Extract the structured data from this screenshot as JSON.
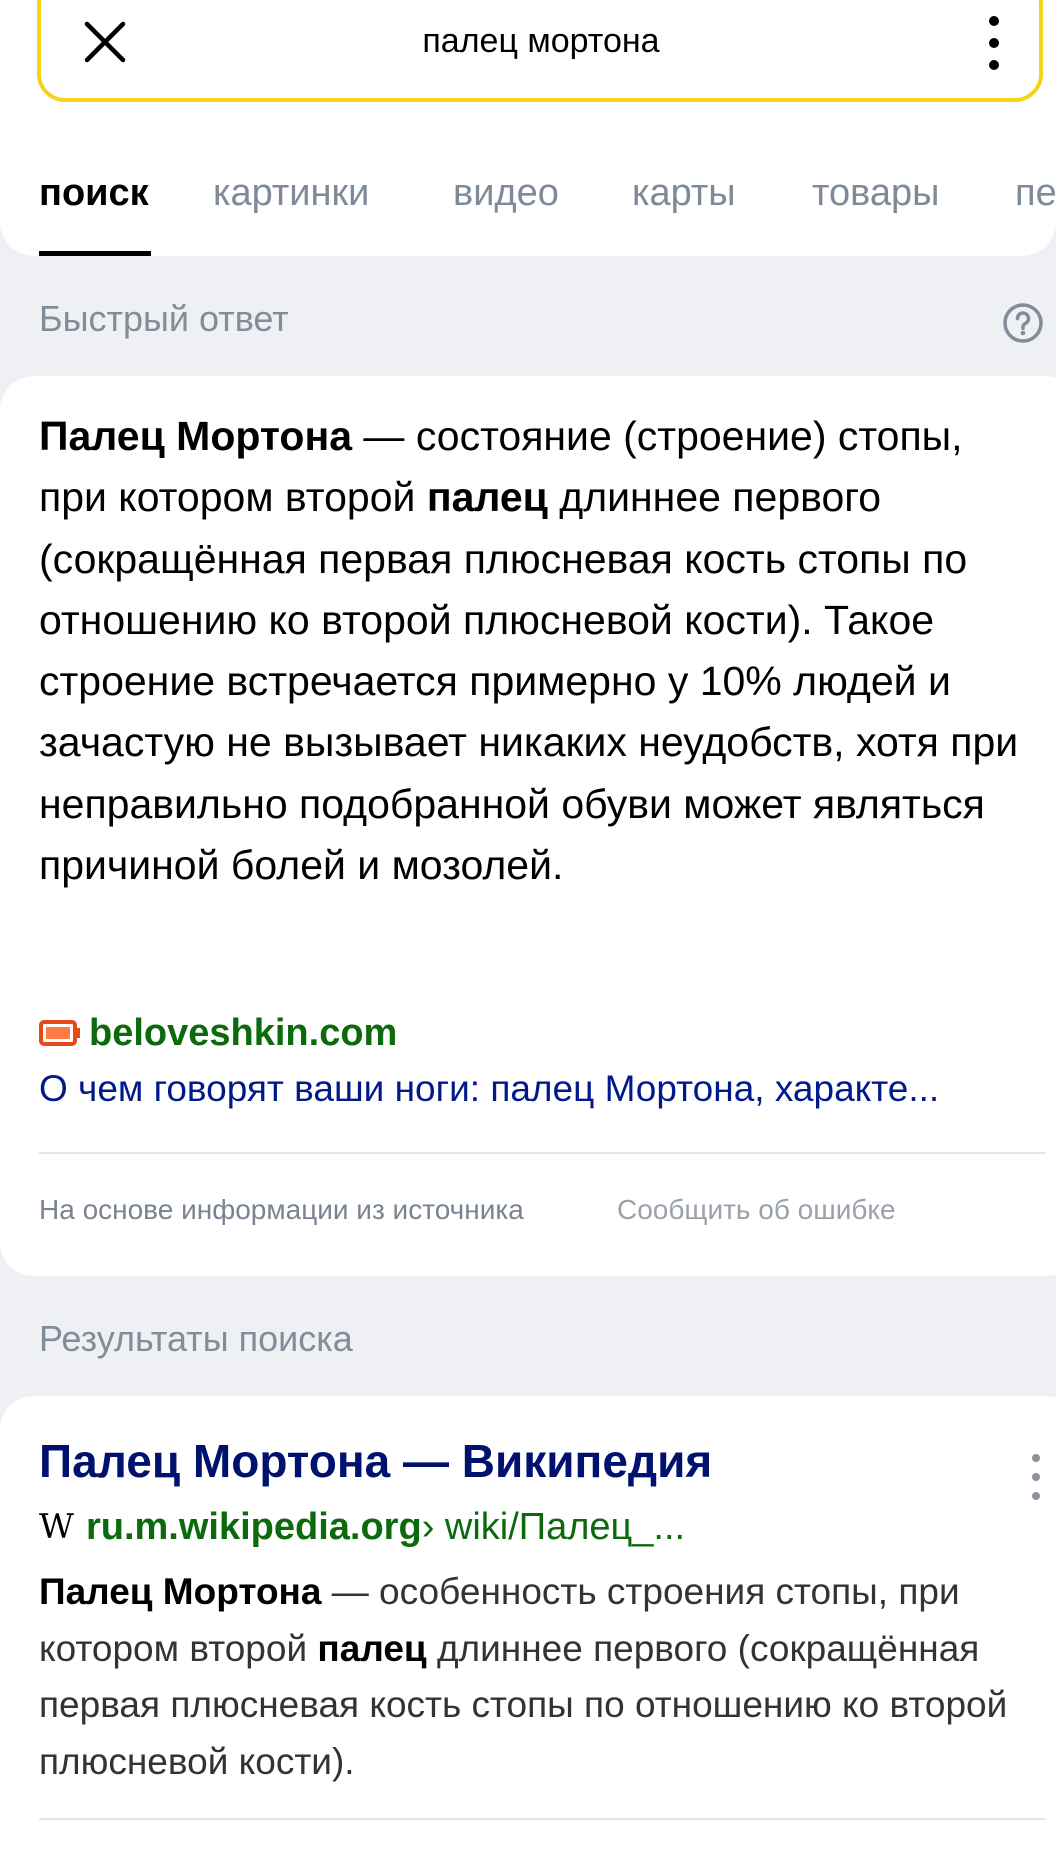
{
  "search": {
    "query": "палец мортона"
  },
  "icons": {
    "close": "close-icon",
    "more": "more-vertical-icon",
    "help": "question-circle-icon",
    "source": "battery-favicon-icon",
    "wiki": "wikipedia-w-icon"
  },
  "colors": {
    "search_border": "#f4d31b",
    "link_blue": "#001a8a",
    "url_green": "#0a6a0c",
    "source_icon": "#e64a19"
  },
  "tabs": [
    {
      "label": "поиск",
      "active": true
    },
    {
      "label": "картинки",
      "active": false
    },
    {
      "label": "видео",
      "active": false
    },
    {
      "label": "карты",
      "active": false
    },
    {
      "label": "товары",
      "active": false
    },
    {
      "label": "пе",
      "active": false
    }
  ],
  "quick_answer": {
    "section_label": "Быстрый ответ",
    "term": "Палец Мортона",
    "text_1": " — состояние (строение) стопы, при котором второй ",
    "term_2": "палец",
    "text_2": " длиннее первого (сокращённая первая плюсневая кость стопы по отношению ко второй плюсневой кости). Такое строение встречается примерно у 10% людей и зачастую не вызывает никаких неудобств, хотя при неправильно подобранной обуви может являться причиной болей и мозолей.",
    "source_domain": "beloveshkin.com",
    "source_title": "О чем говорят ваши ноги: палец Мортона, характе...",
    "footer_note": "На основе информации из источника",
    "report": "Сообщить об ошибке"
  },
  "results": {
    "section_label": "Результаты поиска",
    "items": [
      {
        "title": "Палец Мортона — Википедия",
        "wiki_glyph": "W",
        "domain": "ru.m.wikipedia.org",
        "path": " › wiki/Палец_...",
        "snippet_term": "Палец Мортона",
        "snippet_1": " — особенность строения стопы, при котором второй ",
        "snippet_term_2": "палец",
        "snippet_2": " длиннее первого (сокращённая первая плюсневая кость стопы по отношению ко второй плюсневой кости)."
      }
    ]
  }
}
